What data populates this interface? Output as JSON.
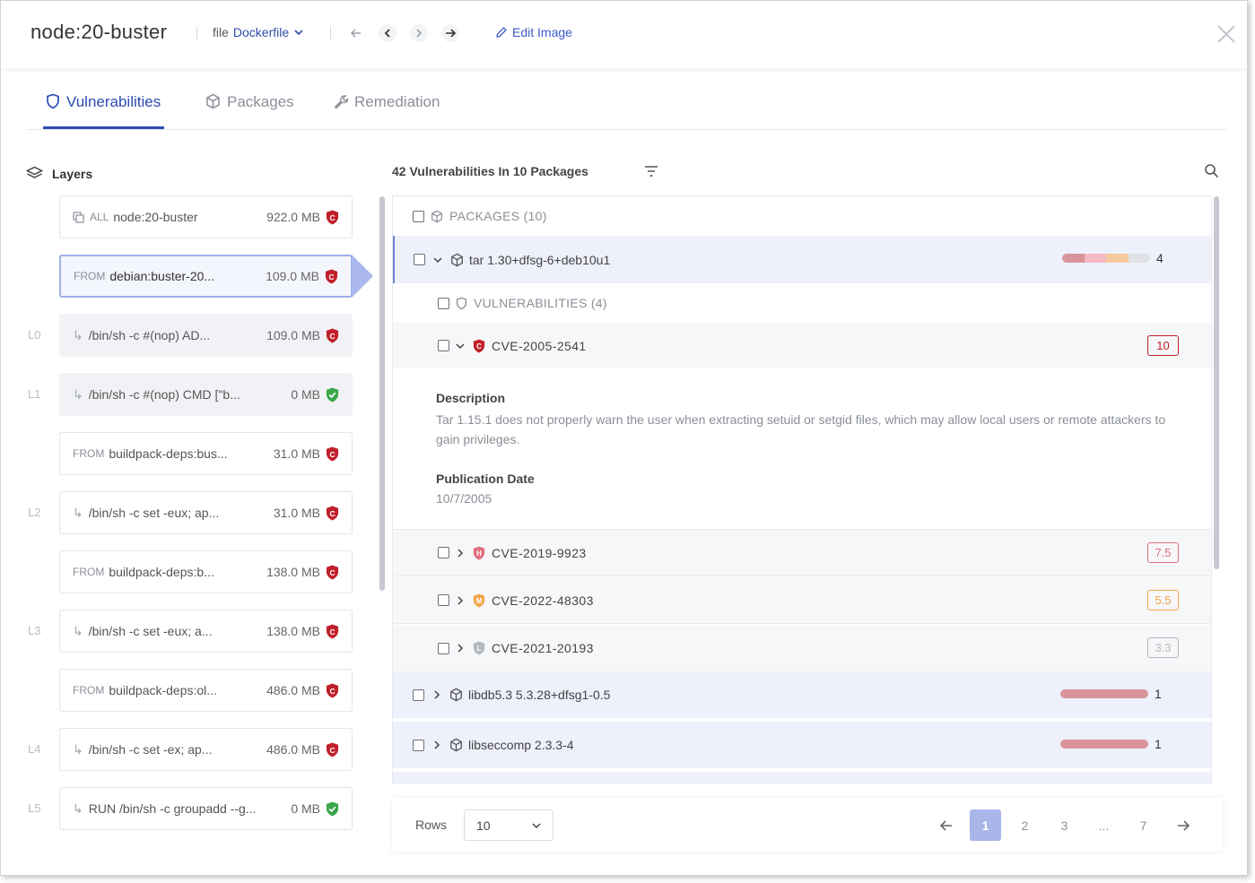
{
  "header": {
    "image_name": "node:20-buster",
    "file_prefix": "file",
    "file_value": "Dockerfile",
    "edit_label": "Edit Image"
  },
  "tabs": [
    {
      "label": "Vulnerabilities"
    },
    {
      "label": "Packages"
    },
    {
      "label": "Remediation"
    }
  ],
  "layers": {
    "title": "Layers",
    "items": [
      {
        "num": "",
        "keyword": "ALL",
        "command": "node:20-buster",
        "size": "922.0 MB",
        "status": "critical"
      },
      {
        "num": "",
        "keyword": "FROM",
        "command": "debian:buster-20...",
        "size": "109.0 MB",
        "status": "critical"
      },
      {
        "num": "L0",
        "keyword": "",
        "command": "/bin/sh -c #(nop) AD...",
        "size": "109.0 MB",
        "status": "critical"
      },
      {
        "num": "L1",
        "keyword": "",
        "command": "/bin/sh -c #(nop) CMD [\"b...",
        "size": "0 MB",
        "status": "ok"
      },
      {
        "num": "",
        "keyword": "FROM",
        "command": "buildpack-deps:bus...",
        "size": "31.0 MB",
        "status": "critical"
      },
      {
        "num": "L2",
        "keyword": "",
        "command": "/bin/sh -c set -eux; ap...",
        "size": "31.0 MB",
        "status": "critical"
      },
      {
        "num": "",
        "keyword": "FROM",
        "command": "buildpack-deps:b...",
        "size": "138.0 MB",
        "status": "critical"
      },
      {
        "num": "L3",
        "keyword": "",
        "command": "/bin/sh -c set -eux; a...",
        "size": "138.0 MB",
        "status": "critical"
      },
      {
        "num": "",
        "keyword": "FROM",
        "command": "buildpack-deps:ol...",
        "size": "486.0 MB",
        "status": "critical"
      },
      {
        "num": "L4",
        "keyword": "",
        "command": "/bin/sh -c set -ex; ap...",
        "size": "486.0 MB",
        "status": "critical"
      },
      {
        "num": "L5",
        "keyword": "",
        "command": "RUN /bin/sh -c groupadd --g...",
        "size": "0 MB",
        "status": "ok"
      }
    ]
  },
  "summary": "42 Vulnerabilities In 10 Packages",
  "table": {
    "packages_header": "PACKAGES (10)",
    "vulns_header": "VULNERABILITIES (4)",
    "packages": [
      {
        "name": "tar 1.30+dfsg-6+deb10u1",
        "count": "4",
        "severity_mix": [
          0.25,
          0.25,
          0.25,
          0.25
        ]
      },
      {
        "name": "libdb5.3 5.3.28+dfsg1-0.5",
        "count": "1",
        "severity_mix": [
          1,
          0,
          0,
          0
        ]
      },
      {
        "name": "libseccomp 2.3.3-4",
        "count": "1",
        "severity_mix": [
          1,
          0,
          0,
          0
        ]
      }
    ],
    "cves": [
      {
        "id": "CVE-2005-2541",
        "letter": "C",
        "score": "10",
        "color": "#c0202a"
      },
      {
        "id": "CVE-2019-9923",
        "letter": "H",
        "score": "7.5",
        "color": "#e0707c"
      },
      {
        "id": "CVE-2022-48303",
        "letter": "M",
        "score": "5.5",
        "color": "#f0a64a"
      },
      {
        "id": "CVE-2021-20193",
        "letter": "L",
        "score": "3.3",
        "color": "#b4b8bf"
      }
    ],
    "detail": {
      "desc_label": "Description",
      "desc_text": "Tar 1.15.1 does not properly warn the user when extracting setuid or setgid files, which may allow local users or remote attackers to gain privileges.",
      "pub_label": "Publication Date",
      "pub_date": "10/7/2005"
    },
    "severity_colors": [
      "#d9949b",
      "#f3b9c4",
      "#f7c99f",
      "#dfe1e5"
    ]
  },
  "pagination": {
    "rows_label": "Rows",
    "rows_value": "10",
    "pages": [
      "1",
      "2",
      "3",
      "...",
      "7"
    ],
    "current": "1"
  }
}
